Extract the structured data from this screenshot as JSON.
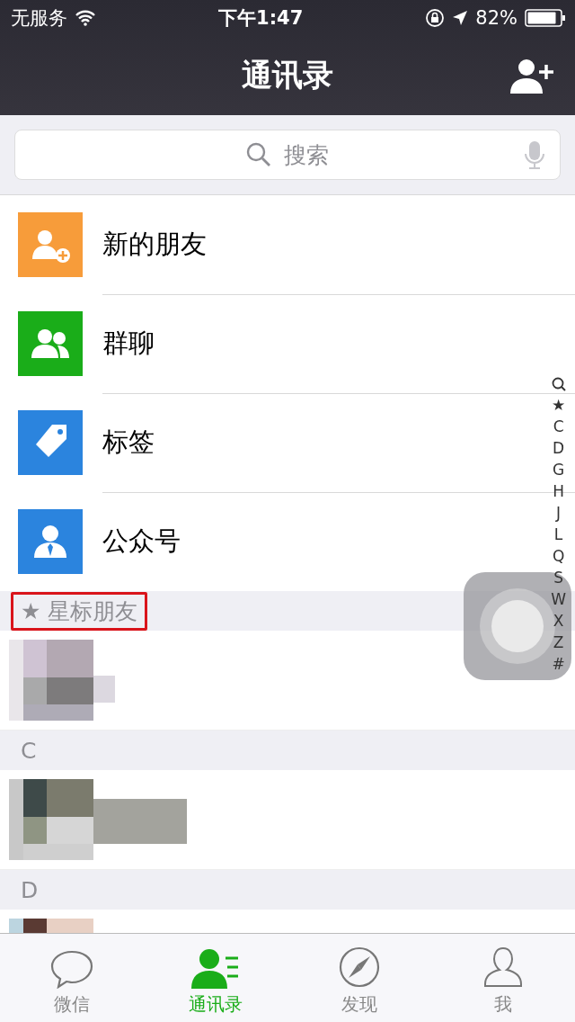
{
  "status_bar": {
    "carrier": "无服务",
    "time": "下午1:47",
    "battery": "82%"
  },
  "nav": {
    "title": "通讯录"
  },
  "search": {
    "placeholder": "搜索"
  },
  "entries": [
    {
      "label": "新的朋友",
      "kind": "new-friend",
      "color": "#f79c3a"
    },
    {
      "label": "群聊",
      "kind": "group",
      "color": "#1aad19"
    },
    {
      "label": "标签",
      "kind": "tag",
      "color": "#2b84de"
    },
    {
      "label": "公众号",
      "kind": "official",
      "color": "#2b84de"
    }
  ],
  "sections": [
    {
      "title": "★ 星标朋友",
      "highlighted": true
    },
    {
      "title": "C",
      "highlighted": false
    },
    {
      "title": "D",
      "highlighted": false
    }
  ],
  "index_bar": [
    "★",
    "C",
    "D",
    "G",
    "H",
    "J",
    "L",
    "Q",
    "S",
    "W",
    "X",
    "Z",
    "#"
  ],
  "tabs": [
    {
      "label": "微信",
      "kind": "chat",
      "selected": false
    },
    {
      "label": "通讯录",
      "kind": "contacts",
      "selected": true
    },
    {
      "label": "发现",
      "kind": "discover",
      "selected": false
    },
    {
      "label": "我",
      "kind": "me",
      "selected": false
    }
  ]
}
